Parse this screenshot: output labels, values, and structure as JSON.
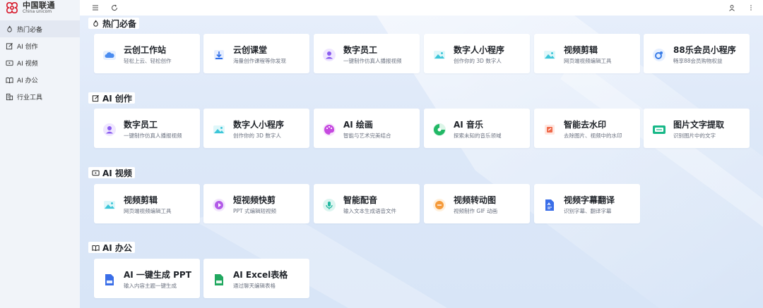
{
  "brand": {
    "name_cn": "中国联通",
    "name_en": "China unicom"
  },
  "sidebar": {
    "items": [
      {
        "label": "热门必备",
        "icon": "flame-icon",
        "active": true
      },
      {
        "label": "AI 创作",
        "icon": "edit-icon"
      },
      {
        "label": "AI 视频",
        "icon": "video-icon"
      },
      {
        "label": "AI 办公",
        "icon": "book-icon"
      },
      {
        "label": "行业工具",
        "icon": "building-icon"
      }
    ]
  },
  "topbar": {
    "icons": [
      "menu-icon",
      "refresh-icon",
      "user-icon",
      "more-icon"
    ]
  },
  "sections": [
    {
      "title": "热门必备",
      "icon": "flame-icon",
      "cards": [
        {
          "title": "云创工作站",
          "desc": "轻松上云、轻松创作",
          "icon": "cloud-icon",
          "color": "#4a8cf0"
        },
        {
          "title": "云创课堂",
          "desc": "海量创作课程等你发现",
          "icon": "download-icon",
          "color": "#2f6fe8"
        },
        {
          "title": "数字员工",
          "desc": "一键制作仿真人播报视频",
          "icon": "avatar-icon",
          "color": "#8a5cf0"
        },
        {
          "title": "数字人小程序",
          "desc": "创作你的 3D 数字人",
          "icon": "image-icon",
          "color": "#3cc6d8"
        },
        {
          "title": "视频剪辑",
          "desc": "网页端视频编辑工具",
          "icon": "image-icon",
          "color": "#3cc6d8"
        },
        {
          "title": "88乐会员小程序",
          "desc": "畅享88会员购物权益",
          "icon": "gift-icon",
          "color": "#3a7de8"
        }
      ]
    },
    {
      "title": "AI 创作",
      "icon": "edit-icon",
      "cards": [
        {
          "title": "数字员工",
          "desc": "一键制作仿真人播报视频",
          "icon": "avatar-icon",
          "color": "#8a5cf0"
        },
        {
          "title": "数字人小程序",
          "desc": "创作你的 3D 数字人",
          "icon": "image-icon",
          "color": "#3cc6d8"
        },
        {
          "title": "AI 绘画",
          "desc": "智能与艺术完美结合",
          "icon": "palette-icon",
          "color": "#c64ae0"
        },
        {
          "title": "AI 音乐",
          "desc": "探索未知的音乐领域",
          "icon": "music-icon",
          "color": "#22b866"
        },
        {
          "title": "智能去水印",
          "desc": "去除图片、视频中的水印",
          "icon": "eraser-icon",
          "color": "#f06a4a"
        },
        {
          "title": "图片文字提取",
          "desc": "识别图片中的文字",
          "icon": "ocr-icon",
          "color": "#18b888"
        }
      ]
    },
    {
      "title": "AI 视频",
      "icon": "video-icon",
      "cards": [
        {
          "title": "视频剪辑",
          "desc": "网页端视频编辑工具",
          "icon": "image-icon",
          "color": "#3cc6d8"
        },
        {
          "title": "短视频快剪",
          "desc": "PPT 式编辑短视频",
          "icon": "clip-icon",
          "color": "#b25ae8"
        },
        {
          "title": "智能配音",
          "desc": "输入文本生成语音文件",
          "icon": "voice-icon",
          "color": "#22b8a0"
        },
        {
          "title": "视频转动图",
          "desc": "视频制作 GIF 动画",
          "icon": "gif-icon",
          "color": "#f59a3a"
        },
        {
          "title": "视频字幕翻译",
          "desc": "识别字幕、翻译字幕",
          "icon": "subtitle-icon",
          "color": "#3a6ee8"
        }
      ]
    },
    {
      "title": "AI 办公",
      "icon": "book-icon",
      "cards": [
        {
          "title": "AI 一键生成 PPT",
          "desc": "输入内容主题一键生成",
          "icon": "ppt-icon",
          "color": "#3a6ee8"
        },
        {
          "title": "AI Excel表格",
          "desc": "通过聊天编辑表格",
          "icon": "excel-icon",
          "color": "#22a860"
        }
      ]
    }
  ]
}
